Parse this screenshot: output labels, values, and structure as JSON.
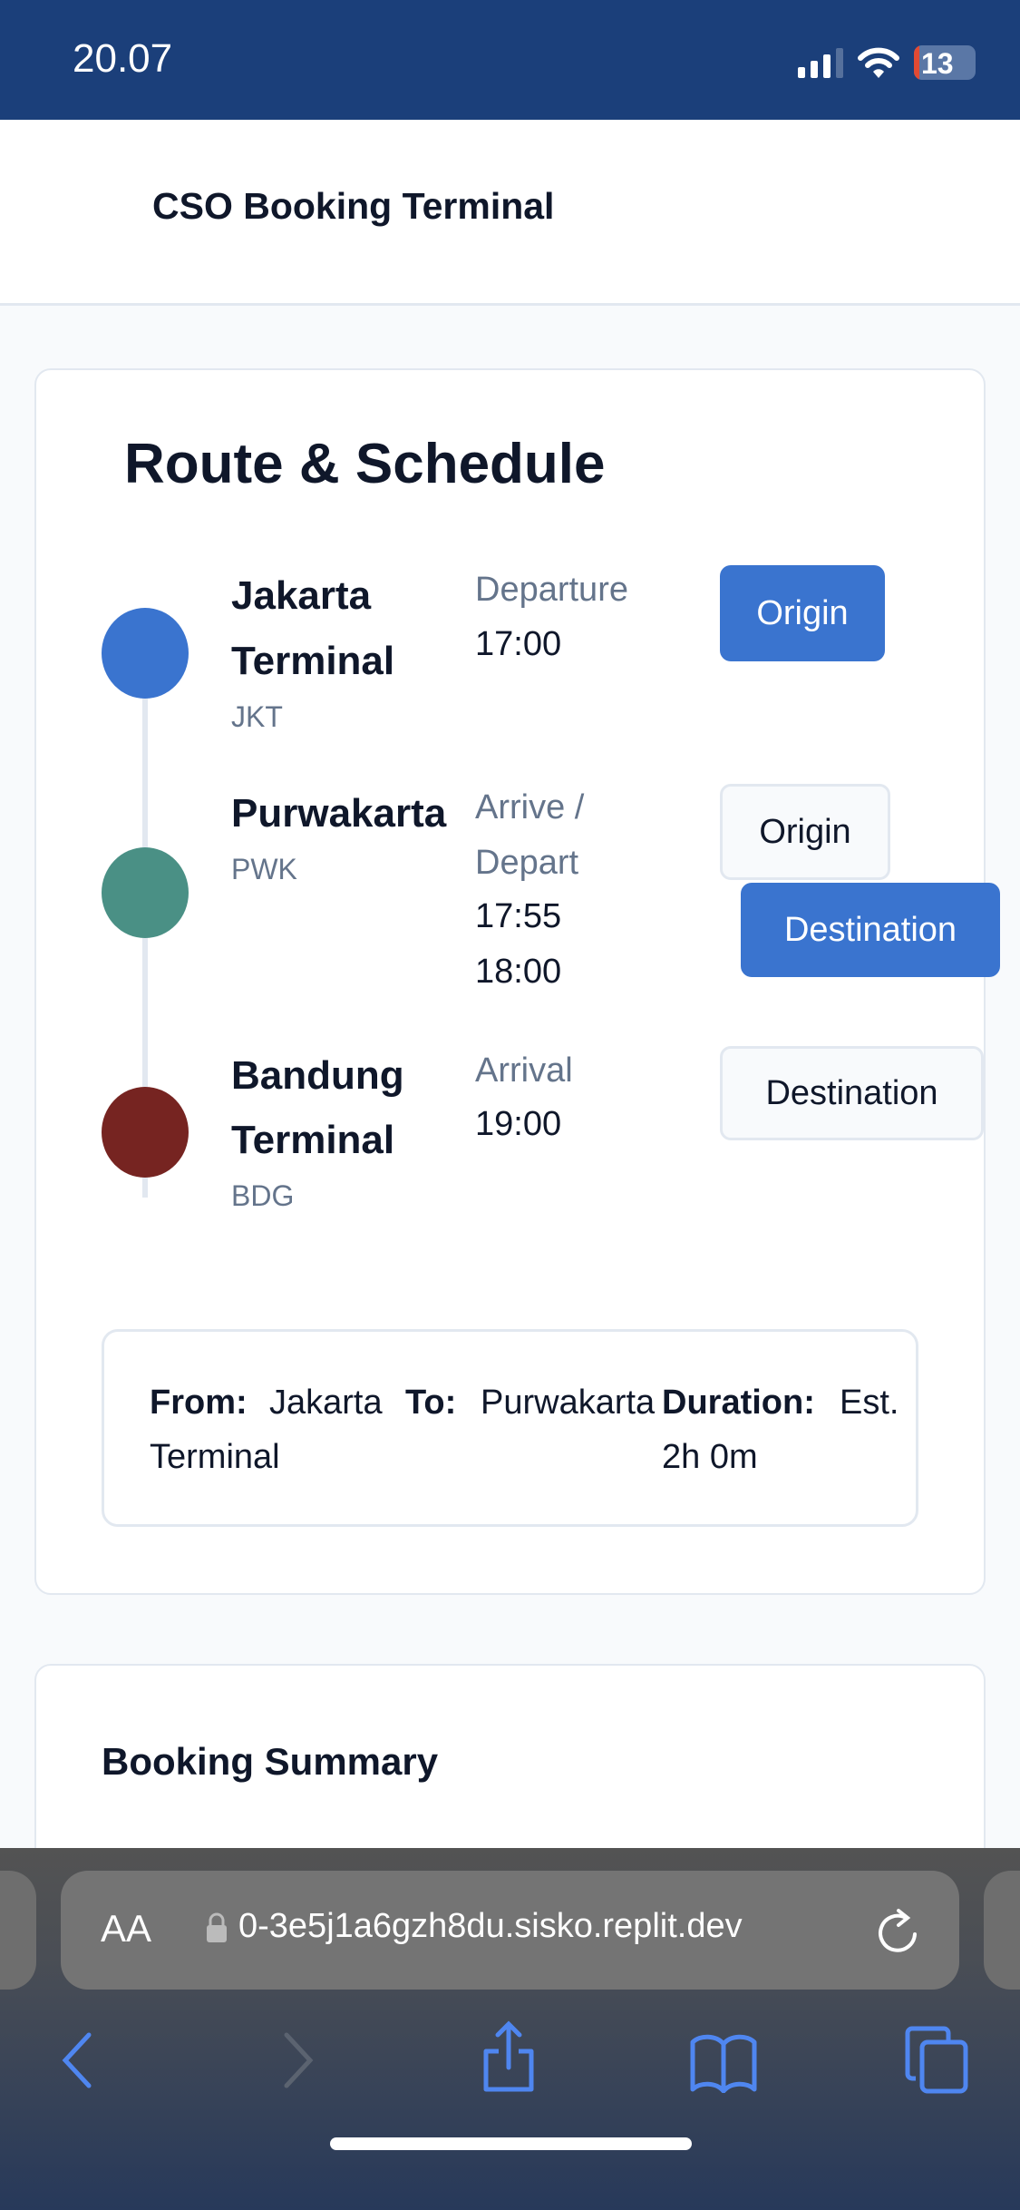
{
  "status_bar": {
    "time": "20.07",
    "battery": "13"
  },
  "header": {
    "title": "CSO Booking Terminal"
  },
  "route": {
    "title": "Route & Schedule",
    "stops": [
      {
        "name_lines": [
          "Jakarta",
          "Terminal"
        ],
        "code": "JKT",
        "time_label": "Departure",
        "times": [
          "17:00"
        ],
        "color": "#3a74cf"
      },
      {
        "name_lines": [
          "Purwakarta"
        ],
        "code": "PWK",
        "time_label_lines": [
          "Arrive /",
          "Depart"
        ],
        "times": [
          "17:55",
          "18:00"
        ],
        "color": "#4a9085"
      },
      {
        "name_lines": [
          "Bandung",
          "Terminal"
        ],
        "code": "BDG",
        "time_label": "Arrival",
        "times": [
          "19:00"
        ],
        "color": "#762421"
      }
    ],
    "buttons": {
      "origin": "Origin",
      "destination": "Destination"
    },
    "summary": {
      "from_label": "From:",
      "from_value": "Jakarta Terminal",
      "to_label": "To:",
      "to_value": "Purwakarta",
      "duration_label": "Duration:",
      "duration_value": "Est. 2h 0m"
    }
  },
  "booking_summary": {
    "title": "Booking Summary"
  },
  "browser": {
    "aa": "AA",
    "url": "0-3e5j1a6gzh8du.sisko.replit.dev"
  },
  "colors": {
    "status_bar": "#1b3f7a",
    "accent": "#3a74cf"
  }
}
